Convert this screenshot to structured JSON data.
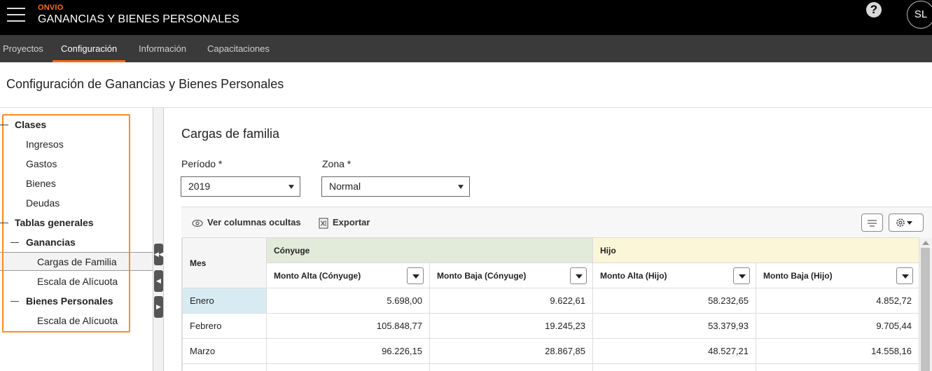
{
  "header": {
    "brand": "ONVIO",
    "app_title": "GANANCIAS Y BIENES PERSONALES",
    "help_label": "?",
    "avatar_initials": "SL"
  },
  "nav": {
    "tabs": [
      {
        "label": "Proyectos"
      },
      {
        "label": "Configuración"
      },
      {
        "label": "Información"
      },
      {
        "label": "Capacitaciones"
      }
    ]
  },
  "page": {
    "title": "Configuración de Ganancias y Bienes Personales"
  },
  "tree": {
    "clases": "Clases",
    "ingresos": "Ingresos",
    "gastos": "Gastos",
    "bienes": "Bienes",
    "deudas": "Deudas",
    "tablas_generales": "Tablas generales",
    "ganancias": "Ganancias",
    "cargas_familia": "Cargas de Familia",
    "escala_alicuota_1": "Escala de Alícuota",
    "bienes_personales": "Bienes Personales",
    "escala_alicuota_2": "Escala de Alícuota"
  },
  "section": {
    "title": "Cargas de familia",
    "periodo_label": "Período *",
    "periodo_value": "2019",
    "zona_label": "Zona *",
    "zona_value": "Normal"
  },
  "toolbar": {
    "ver_columnas": "Ver columnas ocultas",
    "exportar": "Exportar"
  },
  "grid": {
    "mes_header": "Mes",
    "group_conyuge": "Cónyuge",
    "group_hijo": "Hijo",
    "columns": [
      "Monto Alta (Cónyuge)",
      "Monto Baja (Cónyuge)",
      "Monto Alta (Hijo)",
      "Monto Baja (Hijo)"
    ],
    "rows": [
      {
        "mes": "Enero",
        "v1": "5.698,00",
        "v2": "9.622,61",
        "v3": "58.232,65",
        "v4": "4.852,72"
      },
      {
        "mes": "Febrero",
        "v1": "105.848,77",
        "v2": "19.245,23",
        "v3": "53.379,93",
        "v4": "9.705,44"
      },
      {
        "mes": "Marzo",
        "v1": "96.226,15",
        "v2": "28.867,85",
        "v3": "48.527,21",
        "v4": "14.558,16"
      }
    ]
  },
  "colors": {
    "accent": "#ff6a13",
    "topbar": "#000000",
    "navbar": "#3a3a3a",
    "conyuge_header": "#e2ead9",
    "hijo_header": "#fcf6d8",
    "selected_cell": "#d8ebf3"
  }
}
